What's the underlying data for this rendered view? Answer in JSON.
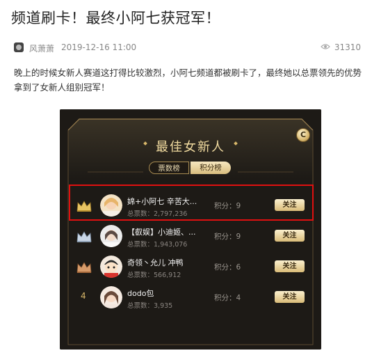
{
  "article": {
    "title": "频道刷卡！最终小阿七获冠军！",
    "author": "风萧萧",
    "date": "2019-12-16 11:00",
    "views": "31310",
    "description": "晚上的时候女新人赛道这打得比较激烈，小阿七频道都被刷卡了，最终她以总票领先的优势拿到了女新人组别冠军！"
  },
  "panel": {
    "coin_label": "C",
    "title": "最佳女新人",
    "tabs": [
      "票数榜",
      "积分榜"
    ],
    "rows": [
      {
        "rank": "1",
        "name": "婂+小阿七 辛苦大...",
        "votes": "总票数：2,797,236",
        "score": "积分：9",
        "follow": "关注"
      },
      {
        "rank": "2",
        "name": "【叡娱】小迪姬、...",
        "votes": "总票数：1,943,076",
        "score": "积分：9",
        "follow": "关注"
      },
      {
        "rank": "3",
        "name": "奇领丶允儿 冲鸭",
        "votes": "总票数：566,912",
        "score": "积分：6",
        "follow": "关注"
      },
      {
        "rank": "4",
        "name": "dodo包",
        "votes": "总票数：3,935",
        "score": "积分：4",
        "follow": "关注"
      }
    ]
  },
  "colors": {
    "accent_gold": "#d9b86a",
    "panel_bg": "#1d1a16",
    "highlight_red": "#e01010"
  }
}
